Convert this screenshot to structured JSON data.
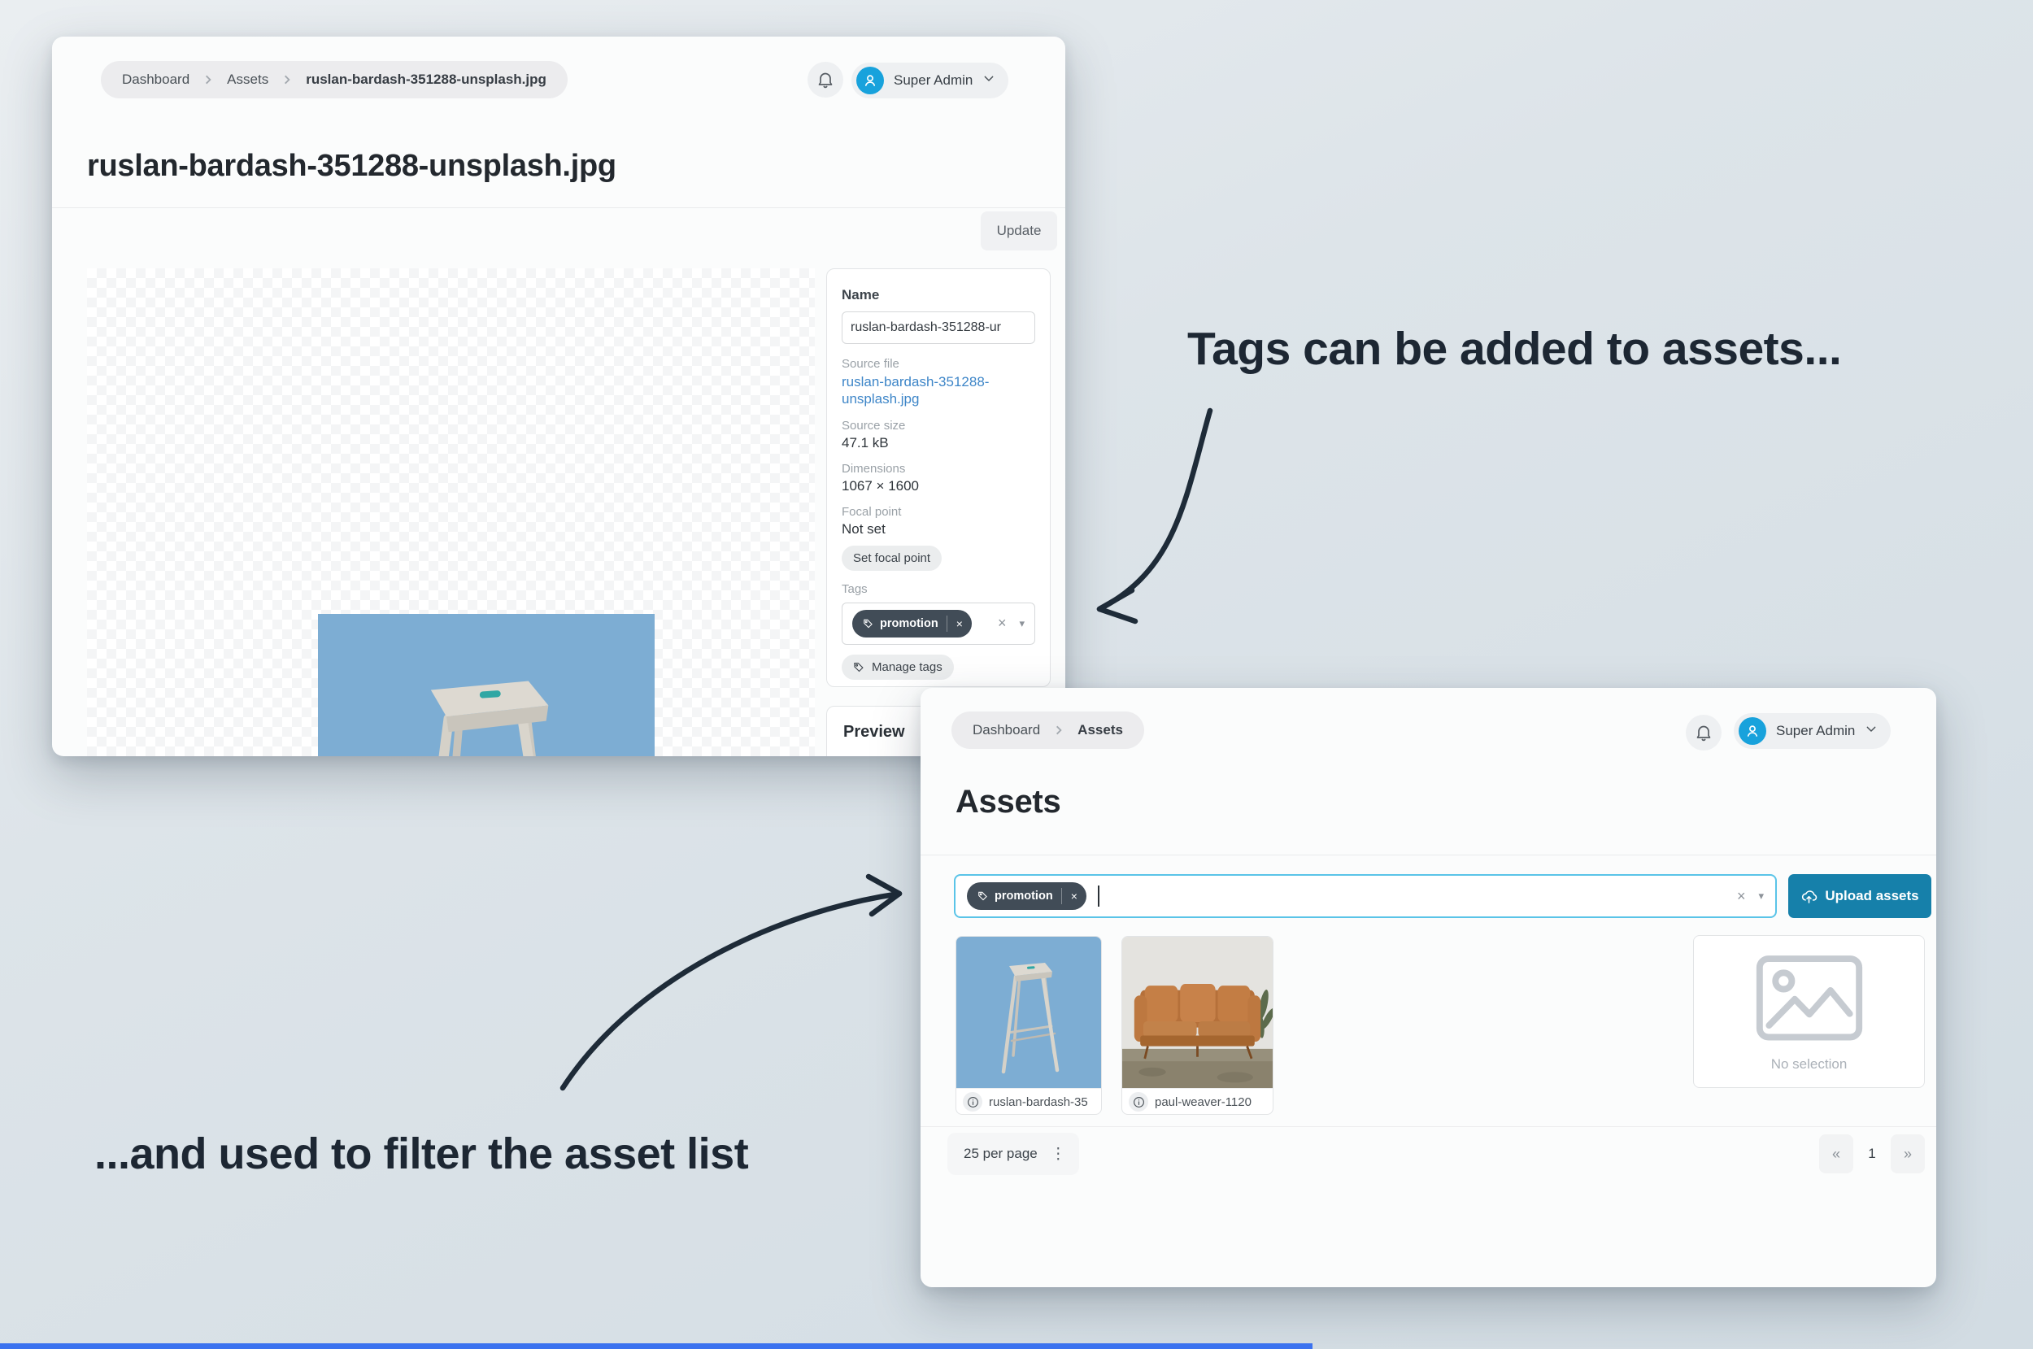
{
  "annotations": {
    "tags_note": "Tags can be added to assets...",
    "filter_note": "...and used to filter the asset list"
  },
  "detail_window": {
    "breadcrumb": [
      "Dashboard",
      "Assets",
      "ruslan-bardash-351288-unsplash.jpg"
    ],
    "user_name": "Super Admin",
    "title": "ruslan-bardash-351288-unsplash.jpg",
    "update_button": "Update",
    "fields": {
      "name_label": "Name",
      "name_value": "ruslan-bardash-351288-ur",
      "source_file_label": "Source file",
      "source_file_line1": "ruslan-bardash-351288-",
      "source_file_line2": "unsplash.jpg",
      "source_size_label": "Source size",
      "source_size_value": "47.1 kB",
      "dimensions_label": "Dimensions",
      "dimensions_value": "1067 × 1600",
      "focal_label": "Focal point",
      "focal_value": "Not set",
      "set_focal_button": "Set focal point",
      "tags_label": "Tags",
      "tag_chip": "promotion",
      "manage_tags_button": "Manage tags"
    },
    "preview_heading": "Preview"
  },
  "list_window": {
    "breadcrumb": [
      "Dashboard",
      "Assets"
    ],
    "user_name": "Super Admin",
    "title": "Assets",
    "filter_chip": "promotion",
    "upload_button": "Upload assets",
    "assets": [
      {
        "label": "ruslan-bardash-35"
      },
      {
        "label": "paul-weaver-1120"
      }
    ],
    "no_selection_text": "No selection",
    "per_page": "25 per page",
    "page_number": "1"
  },
  "glyphs": {
    "chip_close": "×",
    "clear": "×",
    "caret": "▾",
    "kebab": "⋮",
    "pager_prev": "«",
    "pager_next": "»"
  },
  "colors": {
    "accent_blue": "#1680aa",
    "focus_cyan": "#5ac4e8",
    "chip_slate": "#414c57",
    "avatar_blue": "#18a2dc",
    "link_blue": "#3e86c8",
    "annotation_ink": "#1d2733",
    "progress_blue": "#3b72ef"
  }
}
